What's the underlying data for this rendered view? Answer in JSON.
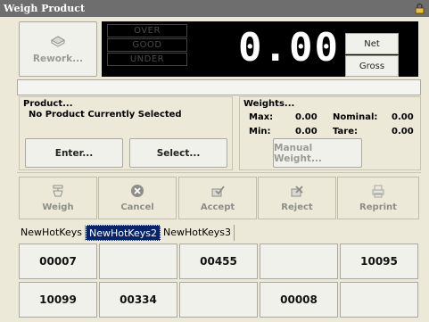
{
  "window": {
    "title": "Weigh Product"
  },
  "buttons": {
    "rework": "Rework...",
    "enter": "Enter...",
    "select": "Select...",
    "manual_weight": "Manual Weight..."
  },
  "display": {
    "indicators": [
      "OVER",
      "GOOD",
      "UNDER"
    ],
    "weight": "0.00",
    "modes": {
      "net": "Net",
      "gross": "Gross"
    }
  },
  "product": {
    "header": "Product...",
    "status": "No Product Currently Selected"
  },
  "weights": {
    "header": "Weights...",
    "max_label": "Max:",
    "max_value": "0.00",
    "min_label": "Min:",
    "min_value": "0.00",
    "nominal_label": "Nominal:",
    "nominal_value": "0.00",
    "tare_label": "Tare:",
    "tare_value": "0.00"
  },
  "toolbar": {
    "weigh": "Weigh",
    "cancel": "Cancel",
    "accept": "Accept",
    "reject": "Reject",
    "reprint": "Reprint"
  },
  "tabs": [
    "NewHotKeys",
    "NewHotKeys2",
    "NewHotKeys3"
  ],
  "hotkeys": {
    "row1": [
      "00007",
      "",
      "00455",
      "",
      "10095"
    ],
    "row2": [
      "10099",
      "00334",
      "",
      "00008",
      ""
    ]
  },
  "icons": {
    "title": "lock-icon",
    "rework": "rework-icon",
    "weigh": "scale-icon",
    "cancel": "cancel-icon",
    "accept": "accept-icon",
    "reject": "reject-icon",
    "reprint": "reprint-icon"
  }
}
